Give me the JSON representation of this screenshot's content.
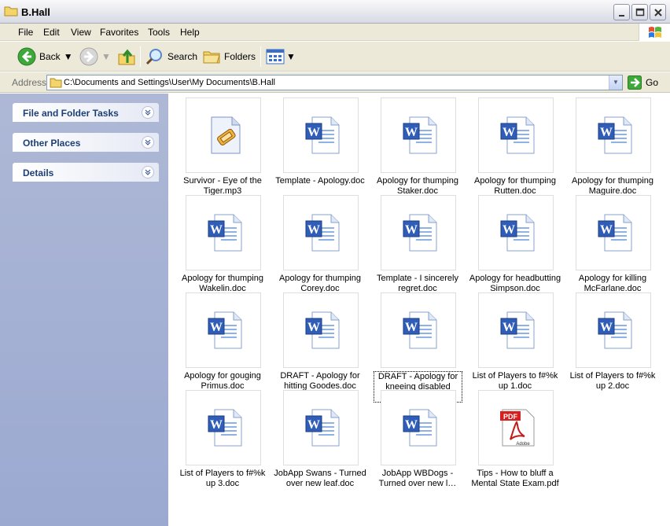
{
  "window": {
    "title": "B.Hall"
  },
  "menu": [
    "File",
    "Edit",
    "View",
    "Favorites",
    "Tools",
    "Help"
  ],
  "toolbar": {
    "back_label": "Back",
    "search_label": "Search",
    "folders_label": "Folders"
  },
  "address": {
    "label": "Address",
    "path": "C:\\Documents and Settings\\User\\My Documents\\B.Hall",
    "go_label": "Go"
  },
  "taskpane": {
    "sections": [
      {
        "label": "File and Folder Tasks"
      },
      {
        "label": "Other Places"
      },
      {
        "label": "Details"
      }
    ]
  },
  "files": [
    {
      "name": "Survivor - Eye of the Tiger.mp3",
      "type": "mp3"
    },
    {
      "name": "Template - Apology.doc",
      "type": "doc"
    },
    {
      "name": "Apology for thumping Staker.doc",
      "type": "doc"
    },
    {
      "name": "Apology for thumping Rutten.doc",
      "type": "doc"
    },
    {
      "name": "Apology for thumping Maguire.doc",
      "type": "doc"
    },
    {
      "name": "Apology for thumping Wakelin.doc",
      "type": "doc"
    },
    {
      "name": "Apology for thumping Corey.doc",
      "type": "doc"
    },
    {
      "name": "Template - I sincerely regret.doc",
      "type": "doc"
    },
    {
      "name": "Apology for headbutting Simpson.doc",
      "type": "doc"
    },
    {
      "name": "Apology for killing McFarlane.doc",
      "type": "doc"
    },
    {
      "name": "Apology for gouging Primus.doc",
      "type": "doc"
    },
    {
      "name": "DRAFT - Apology for hitting Goodes.doc",
      "type": "doc"
    },
    {
      "name": "DRAFT - Apology for kneeing disabled boy.doc",
      "type": "doc",
      "selected": true
    },
    {
      "name": "List of Players to f#%k up 1.doc",
      "type": "doc"
    },
    {
      "name": "List of Players to f#%k up 2.doc",
      "type": "doc"
    },
    {
      "name": "List of Players to f#%k up 3.doc",
      "type": "doc"
    },
    {
      "name": "JobApp Swans - Turned over new leaf.doc",
      "type": "doc"
    },
    {
      "name": "JobApp WBDogs - Turned over new l…",
      "type": "doc"
    },
    {
      "name": "Tips - How to bluff a Mental State Exam.pdf",
      "type": "pdf"
    }
  ]
}
